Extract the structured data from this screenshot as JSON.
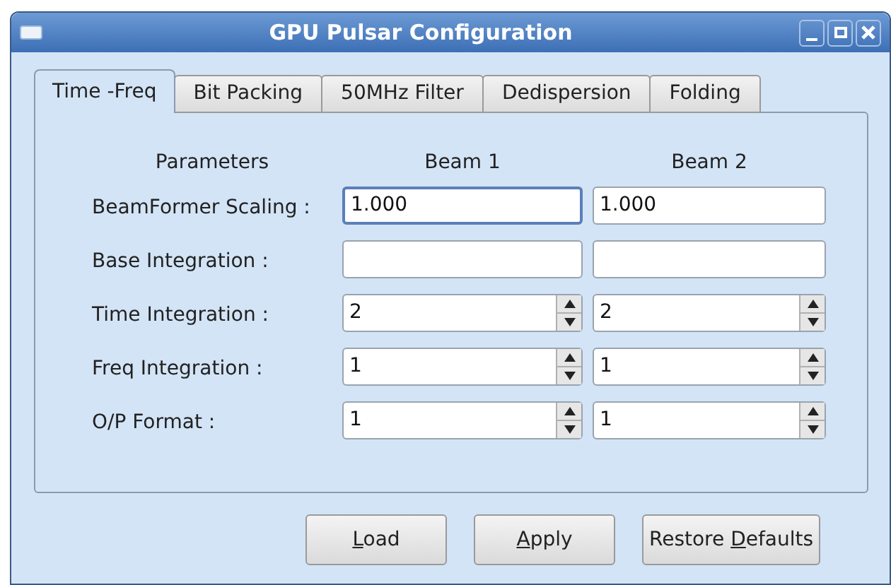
{
  "window": {
    "title": "GPU Pulsar Configuration"
  },
  "tabs": [
    {
      "label": "Time -Freq",
      "selected": true
    },
    {
      "label": "Bit Packing",
      "selected": false
    },
    {
      "label": "50MHz Filter",
      "selected": false
    },
    {
      "label": "Dedispersion",
      "selected": false
    },
    {
      "label": "Folding",
      "selected": false
    }
  ],
  "columns": [
    "Parameters",
    "Beam 1",
    "Beam 2"
  ],
  "rows": [
    {
      "label": "BeamFormer Scaling :",
      "kind": "text",
      "values": [
        {
          "value": "1.000",
          "focused": true
        },
        {
          "value": "1.000",
          "focused": false
        }
      ]
    },
    {
      "label": "Base Integration :",
      "kind": "text",
      "values": [
        {
          "focused": false
        },
        {
          "focused": false
        }
      ]
    },
    {
      "label": "Time Integration :",
      "kind": "spin",
      "values": [
        {
          "value": "2",
          "focused": false
        },
        {
          "value": "2",
          "focused": false
        }
      ]
    },
    {
      "label": "Freq Integration :",
      "kind": "spin",
      "values": [
        {
          "value": "1",
          "focused": false
        },
        {
          "value": "1",
          "focused": false
        }
      ]
    },
    {
      "label": "O/P Format :",
      "kind": "spin",
      "values": [
        {
          "value": "1",
          "focused": false
        },
        {
          "value": "1",
          "focused": false
        }
      ]
    }
  ],
  "buttons": [
    {
      "key": "L",
      "after": "oad"
    },
    {
      "key": "A",
      "after": "pply"
    },
    {
      "before": "Restore ",
      "key": "D",
      "after": "efaults"
    }
  ]
}
